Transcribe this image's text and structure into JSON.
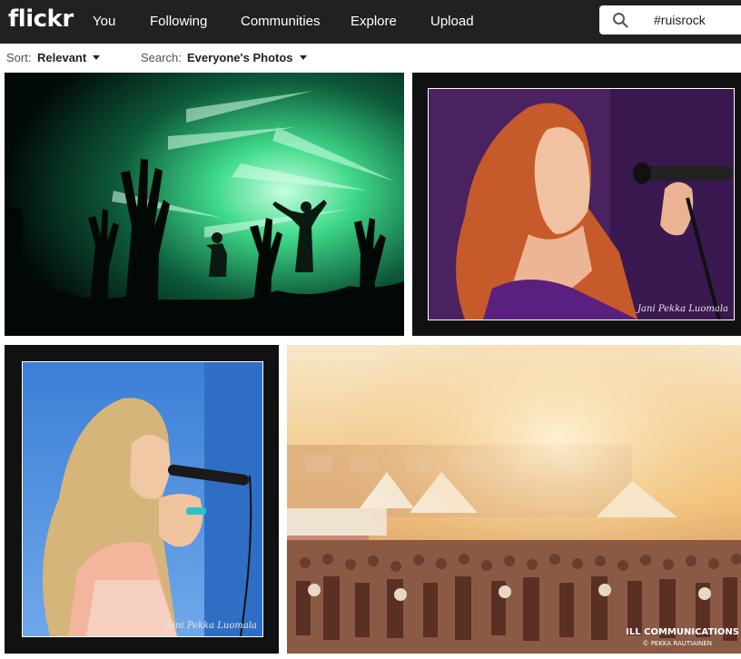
{
  "header": {
    "logo": "flickr",
    "nav": [
      "You",
      "Following",
      "Communities",
      "Explore",
      "Upload"
    ],
    "search_value": "#ruisrock"
  },
  "filters": {
    "sort_label": "Sort:",
    "sort_value": "Relevant",
    "search_label": "Search:",
    "search_value": "Everyone's Photos"
  },
  "photos": [
    {
      "subject": "concert stage with green lights and raised hands"
    },
    {
      "subject": "red-haired singer with microphone",
      "watermark": "Jani Pekka Luomala"
    },
    {
      "subject": "blonde singer with microphone",
      "watermark": "Jani Pekka Luomala"
    },
    {
      "subject": "festival crowd in golden sunlight",
      "watermark_line1": "ILL COMMUNICATIONS",
      "watermark_line2": "© PEKKA RAUTIAINEN"
    }
  ],
  "colors": {
    "topbar": "#212124",
    "accent_green": "#3fd98a"
  }
}
